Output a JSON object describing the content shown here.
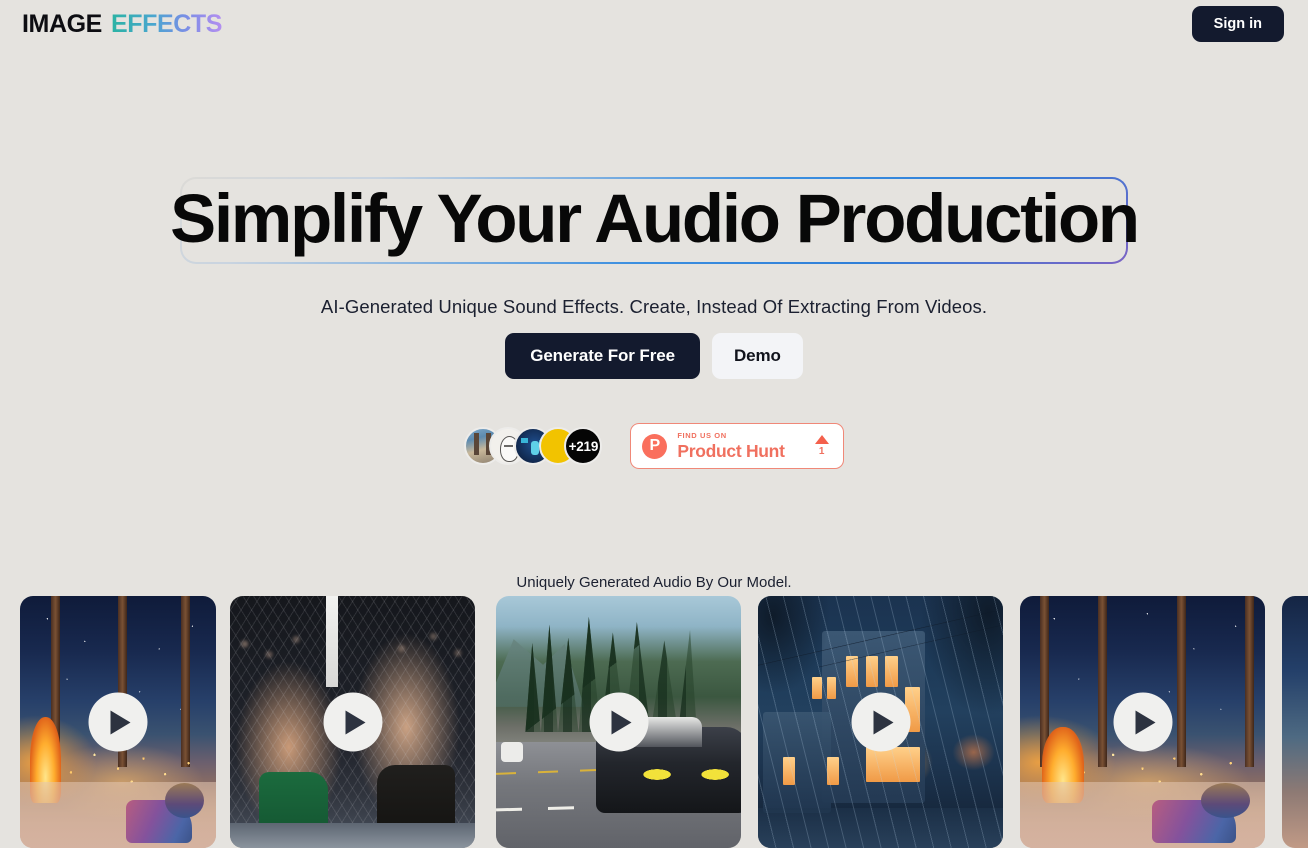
{
  "header": {
    "logo_primary": "IMAGE",
    "logo_accent": "EFFECTS",
    "signin_label": "Sign in"
  },
  "hero": {
    "headline": "Simplify Your Audio Production",
    "subtitle": "AI-Generated Unique Sound Effects. Create, Instead Of Extracting From Videos.",
    "primary_cta": "Generate For Free",
    "secondary_cta": "Demo"
  },
  "social_proof": {
    "avatar_overflow": "+219",
    "avatars": [
      {
        "name": "avatar-user-1",
        "alt": "outdoor torii path photo"
      },
      {
        "name": "avatar-user-2",
        "alt": "line art portrait"
      },
      {
        "name": "avatar-user-3",
        "alt": "blue anime character"
      },
      {
        "name": "avatar-user-4",
        "alt": "yellow black checker"
      }
    ],
    "product_hunt": {
      "eyebrow": "FIND US ON",
      "name": "Product Hunt",
      "logo_letter": "P",
      "vote_count": "1"
    }
  },
  "showcase": {
    "label": "Uniquely Generated Audio By Our Model.",
    "cards": [
      {
        "scene": "cozy cabin window snowy mountain night",
        "theme": "scene-cabin"
      },
      {
        "scene": "mma fighters in cage",
        "theme": "scene-fight"
      },
      {
        "scene": "black sports car on mountain highway",
        "theme": "scene-car"
      },
      {
        "scene": "rainy night street houses",
        "theme": "scene-rain"
      },
      {
        "scene": "cozy cabin fireplace snowy mountain night",
        "theme": "scene-cabin"
      },
      {
        "scene": "cozy cabin window partial",
        "theme": "scene-edge"
      }
    ]
  },
  "colors": {
    "background": "#e5e3df",
    "dark": "#131a2e",
    "accent_teal": "#2bb3a3",
    "accent_purple": "#b48ef0",
    "product_hunt": "#f0705f",
    "border_blue": "#3b8fe0"
  }
}
